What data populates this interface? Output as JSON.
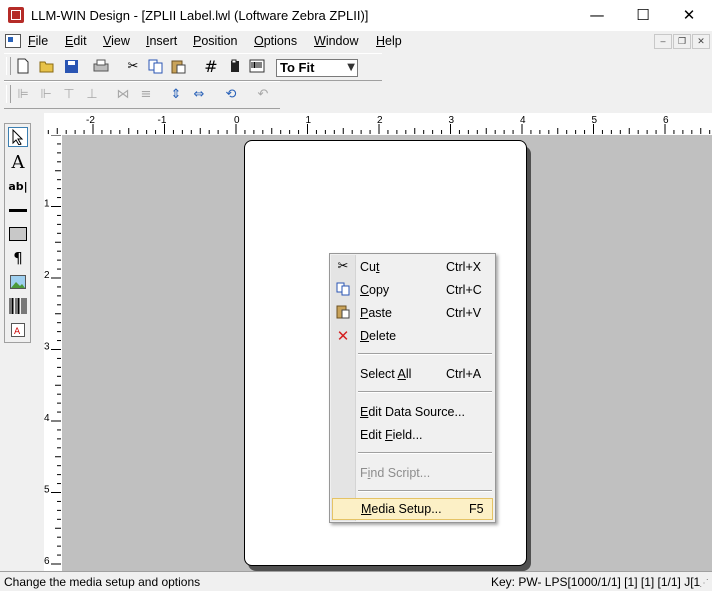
{
  "window": {
    "title": "LLM-WIN Design - [ZPLII Label.lwl (Loftware Zebra ZPLII)]",
    "minimize_glyph": "—",
    "maximize_glyph": "☐",
    "close_glyph": "✕"
  },
  "menubar": {
    "items": [
      {
        "label": "File",
        "u": "F",
        "rest": "ile"
      },
      {
        "label": "Edit",
        "u": "E",
        "rest": "dit"
      },
      {
        "label": "View",
        "u": "V",
        "rest": "iew"
      },
      {
        "label": "Insert",
        "u": "I",
        "rest": "nsert"
      },
      {
        "label": "Position",
        "u": "P",
        "rest": "osition"
      },
      {
        "label": "Options",
        "u": "O",
        "rest": "ptions"
      },
      {
        "label": "Window",
        "u": "W",
        "rest": "indow"
      },
      {
        "label": "Help",
        "u": "H",
        "rest": "elp"
      }
    ],
    "mdi_minimize": "–",
    "mdi_restore": "❐",
    "mdi_close": "✕"
  },
  "toolbar": {
    "zoom_value": "To Fit",
    "icons_row1": [
      "new-icon",
      "open-icon",
      "save-icon",
      "print-icon",
      "cut-icon",
      "copy-icon",
      "paste-icon",
      "grid-icon",
      "properties-icon",
      "barcode-icon"
    ],
    "icons_row2": [
      "align-left-icon",
      "align-right-icon",
      "align-top-icon",
      "align-bottom-icon",
      "space-horizontal-icon",
      "space-vertical-icon",
      "center-vertical-icon",
      "center-horizontal-icon",
      "rotate-icon",
      "undo-icon"
    ]
  },
  "palette": {
    "tools": [
      "select-tool-icon",
      "text-tool-icon",
      "field-tool-icon",
      "line-tool-icon",
      "box-tool-icon",
      "paragraph-tool-icon",
      "image-tool-icon",
      "barcode-tool-icon",
      "rfid-tool-icon"
    ]
  },
  "rulers": {
    "horizontal_labels": [
      "-2",
      "-1",
      "0",
      "1",
      "2",
      "3",
      "4",
      "5",
      "6"
    ],
    "vertical_labels": [
      "1",
      "2",
      "3",
      "4",
      "5",
      "6"
    ]
  },
  "context_menu": {
    "items": [
      {
        "pre": "Cu",
        "u": "t",
        "post": "",
        "shortcut": "Ctrl+X",
        "icon": "cut-icon"
      },
      {
        "pre": "",
        "u": "C",
        "post": "opy",
        "shortcut": "Ctrl+C",
        "icon": "copy-icon"
      },
      {
        "pre": "",
        "u": "P",
        "post": "aste",
        "shortcut": "Ctrl+V",
        "icon": "paste-icon"
      },
      {
        "pre": "",
        "u": "D",
        "post": "elete",
        "shortcut": "",
        "icon": "delete-icon"
      },
      {
        "pre": "Select ",
        "u": "A",
        "post": "ll",
        "shortcut": "Ctrl+A"
      },
      {
        "pre": "",
        "u": "E",
        "post": "dit Data Source...",
        "shortcut": ""
      },
      {
        "pre": "Edit ",
        "u": "F",
        "post": "ield...",
        "shortcut": ""
      },
      {
        "pre": "F",
        "u": "i",
        "post": "nd Script...",
        "shortcut": "",
        "disabled": true
      },
      {
        "pre": "",
        "u": "M",
        "post": "edia Setup...",
        "shortcut": "F5",
        "highlighted": true
      }
    ]
  },
  "statusbar": {
    "message": "Change the media setup and options",
    "key_info": "Key: PW- LPS[1000/1/1] [1] [1] [1/1] J[1"
  }
}
